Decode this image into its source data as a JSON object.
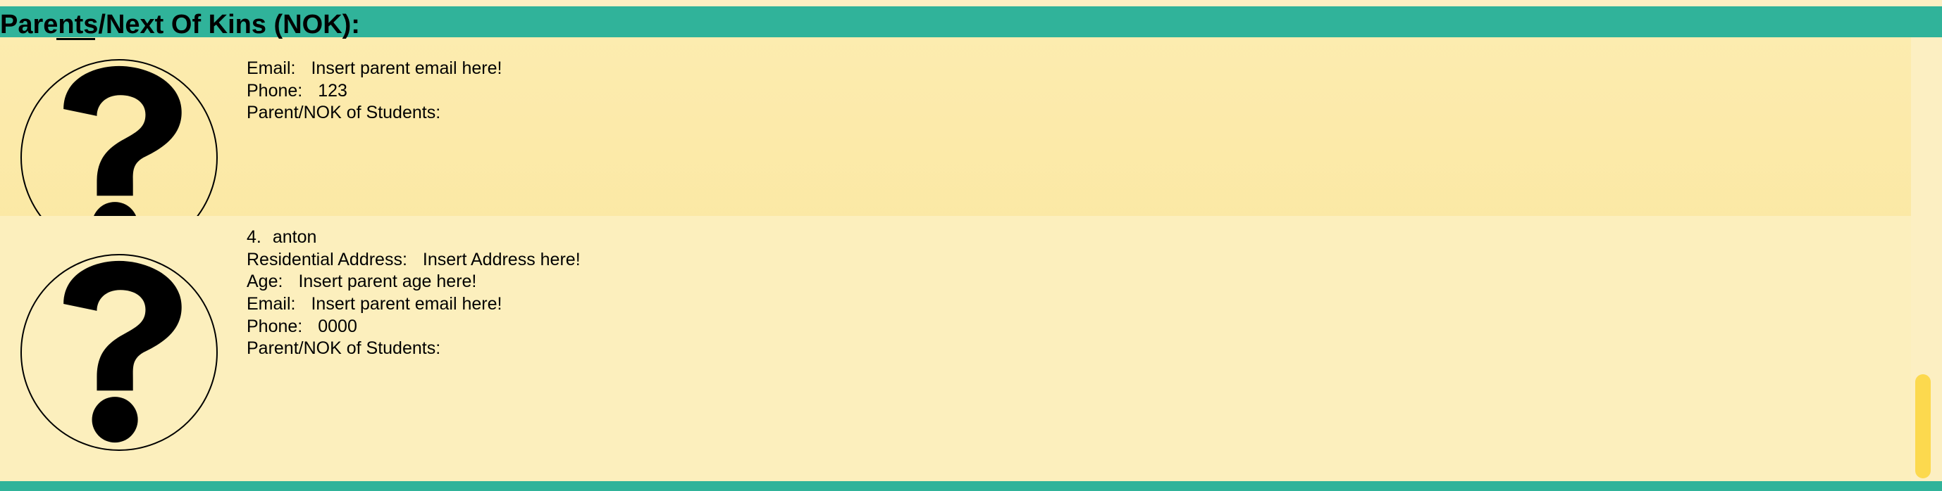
{
  "header": {
    "title": "Parents/Next Of Kins (NOK):"
  },
  "avatar_icon": "question-mark-icon",
  "colors": {
    "header": "#30b39a",
    "card_background": "#fcefbd",
    "scrollbar_thumb": "#fcd94e"
  },
  "parents": [
    {
      "email_label": "Email:",
      "email": "Insert parent email here!",
      "phone_label": "Phone:",
      "phone": "123",
      "students_label": "Parent/NOK of Students:"
    },
    {
      "index": "4.",
      "name": "anton",
      "address_label": "Residential Address:",
      "address": "Insert Address here!",
      "age_label": "Age:",
      "age": "Insert parent age here!",
      "email_label": "Email:",
      "email": "Insert parent email here!",
      "phone_label": "Phone:",
      "phone": "0000",
      "students_label": "Parent/NOK of Students:"
    }
  ]
}
